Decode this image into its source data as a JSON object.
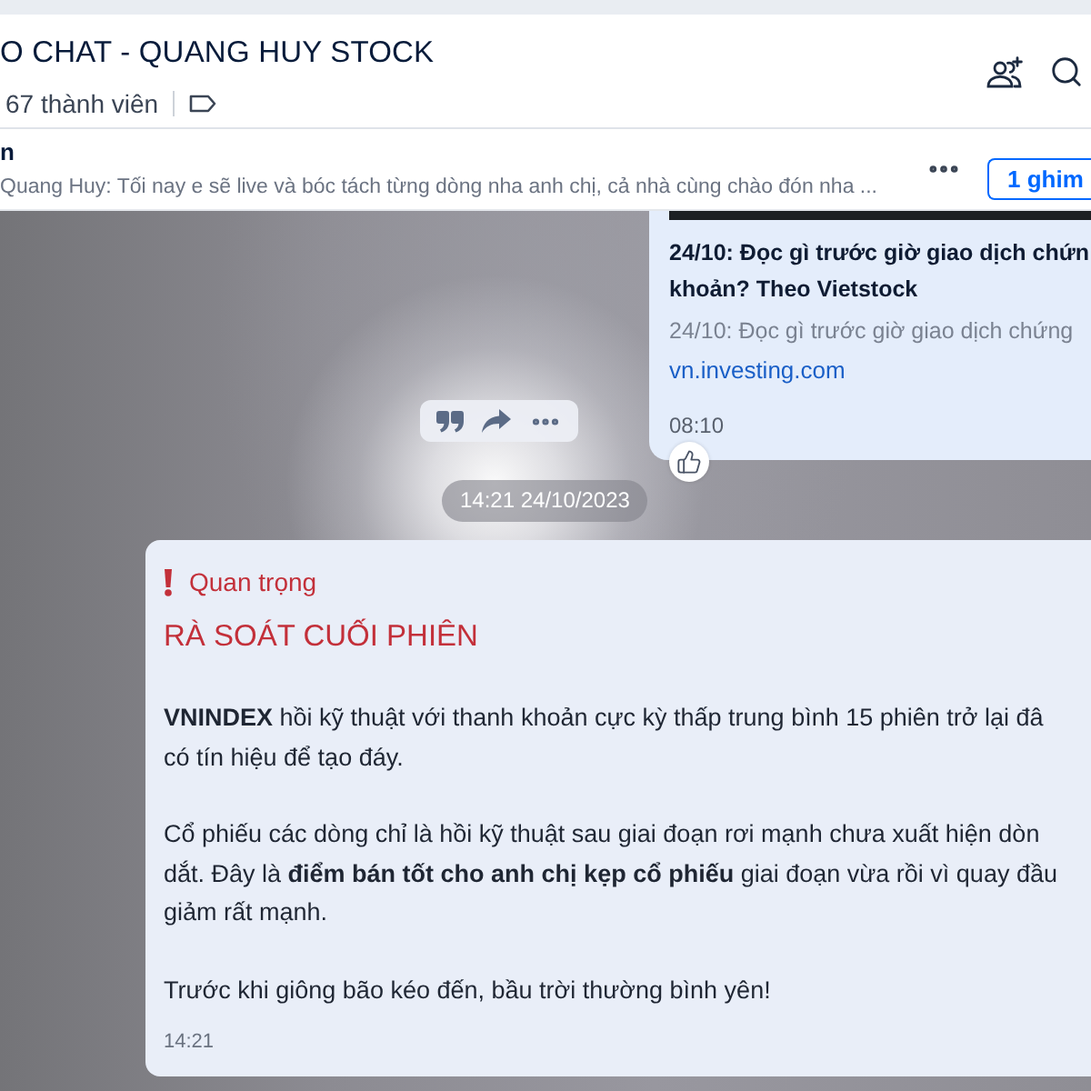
{
  "header": {
    "title": "O CHAT - QUANG HUY STOCK",
    "member_count": "67 thành viên"
  },
  "pinned": {
    "title": "n",
    "preview": "Quang Huy: Tối nay e sẽ live và bóc tách từng dòng nha anh chị, cả nhà cùng chào đón nha ...",
    "button": "1 ghim"
  },
  "link_card": {
    "title_lines": [
      "24/10: Đọc gì trước giờ giao dịch chứn",
      "khoản? Theo Vietstock"
    ],
    "description": "24/10: Đọc gì trước giờ giao dịch chứng",
    "domain": "vn.investing.com",
    "time": "08:10"
  },
  "date_separator": "14:21 24/10/2023",
  "message": {
    "tag": "Quan trọng",
    "heading": "RÀ SOÁT CUỐI PHIÊN",
    "paragraphs": [
      [
        "**VNINDEX** hồi kỹ thuật với thanh khoản cực kỳ thấp trung bình 15 phiên trở lại đâ",
        "có tín hiệu để tạo đáy."
      ],
      [
        "Cổ phiếu các dòng chỉ là hồi kỹ thuật sau giai đoạn rơi mạnh chưa xuất hiện dòn",
        "dắt. Đây là **điểm bán tốt cho anh chị kẹp cổ phiếu** giai đoạn vừa rồi vì quay đầu",
        "giảm rất mạnh."
      ],
      [
        "Trước khi giông bão kéo đến, bầu trời thường bình yên!"
      ]
    ],
    "time": "14:21"
  }
}
